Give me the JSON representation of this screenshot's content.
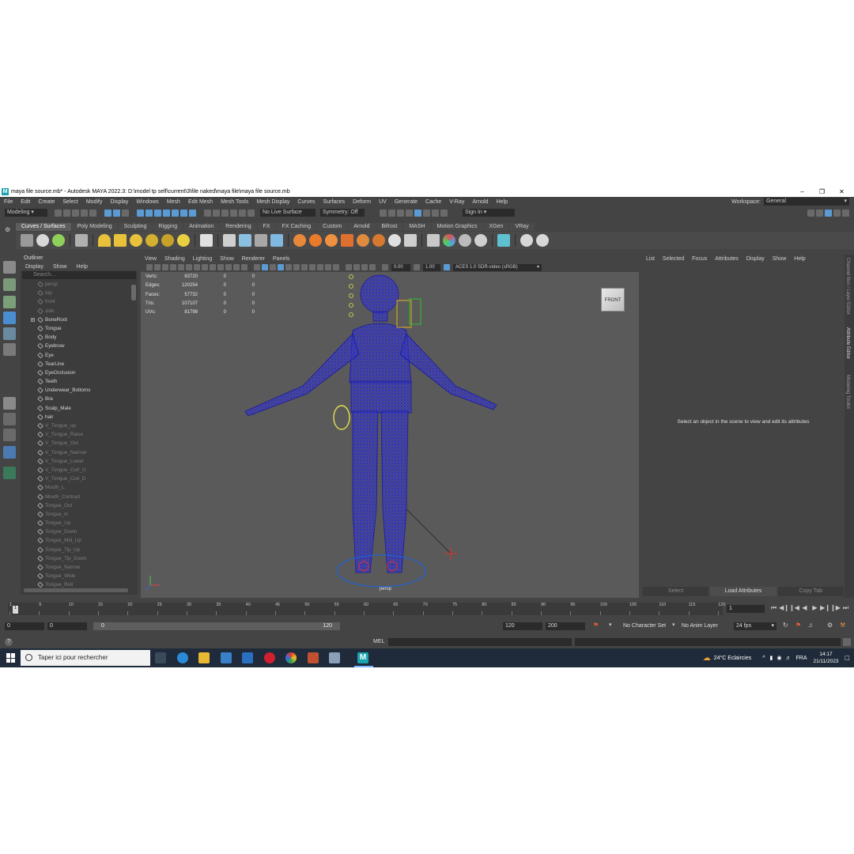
{
  "window": {
    "title": "maya file source.mb* - Autodesk MAYA 2022.3: D:\\model tp self\\current\\3\\file naked\\maya file\\maya file source.mb"
  },
  "menubar": [
    "File",
    "Edit",
    "Create",
    "Select",
    "Modify",
    "Display",
    "Windows",
    "Mesh",
    "Edit Mesh",
    "Mesh Tools",
    "Mesh Display",
    "Curves",
    "Surfaces",
    "Deform",
    "UV",
    "Generate",
    "Cache",
    "V-Ray",
    "Arnold",
    "Help"
  ],
  "workspace": {
    "label": "Workspace:",
    "value": "General"
  },
  "statusline": {
    "mode": "Modeling",
    "live_surface": "No Live Surface",
    "symmetry": "Symmetry: Off",
    "sign_in": "Sign In"
  },
  "shelf_tabs": [
    "Curves / Surfaces",
    "Poly Modeling",
    "Sculpting",
    "Rigging",
    "Animation",
    "Rendering",
    "FX",
    "FX Caching",
    "Custom",
    "Arnold",
    "Bifrost",
    "MASH",
    "Motion Graphics",
    "XGen",
    "VRay"
  ],
  "shelf_active": "Curves / Surfaces",
  "outliner": {
    "title": "Outliner",
    "menus": [
      "Display",
      "Show",
      "Help"
    ],
    "search_placeholder": "Search...",
    "items": [
      {
        "label": "persp",
        "dim": true
      },
      {
        "label": "top",
        "dim": true
      },
      {
        "label": "front",
        "dim": true
      },
      {
        "label": "side",
        "dim": true
      },
      {
        "label": "BoneRoot",
        "dim": false
      },
      {
        "label": "Tongue",
        "dim": false
      },
      {
        "label": "Body",
        "dim": false
      },
      {
        "label": "Eyebrow",
        "dim": false
      },
      {
        "label": "Eye",
        "dim": false
      },
      {
        "label": "TearLine",
        "dim": false
      },
      {
        "label": "EyeOcclusion",
        "dim": false
      },
      {
        "label": "Teeth",
        "dim": false
      },
      {
        "label": "Underwear_Bottoms",
        "dim": false
      },
      {
        "label": "Bra",
        "dim": false
      },
      {
        "label": "Scalp_Male",
        "dim": false
      },
      {
        "label": "hair",
        "dim": false
      },
      {
        "label": "V_Tongue_up",
        "dim": true
      },
      {
        "label": "V_Tongue_Raise",
        "dim": true
      },
      {
        "label": "V_Tongue_Out",
        "dim": true
      },
      {
        "label": "V_Tongue_Narrow",
        "dim": true
      },
      {
        "label": "V_Tongue_Lower",
        "dim": true
      },
      {
        "label": "V_Tongue_Curl_U",
        "dim": true
      },
      {
        "label": "V_Tongue_Curl_D",
        "dim": true
      },
      {
        "label": "Mouth_L",
        "dim": true
      },
      {
        "label": "Mouth_Contract",
        "dim": true
      },
      {
        "label": "Tongue_Out",
        "dim": true
      },
      {
        "label": "Tongue_In",
        "dim": true
      },
      {
        "label": "Tongue_Up",
        "dim": true
      },
      {
        "label": "Tongue_Down",
        "dim": true
      },
      {
        "label": "Tongue_Mid_Up",
        "dim": true
      },
      {
        "label": "Tongue_Tip_Up",
        "dim": true
      },
      {
        "label": "Tongue_Tip_Down",
        "dim": true
      },
      {
        "label": "Tongue_Narrow",
        "dim": true
      },
      {
        "label": "Tongue_Wide",
        "dim": true
      },
      {
        "label": "Tongue_Roll",
        "dim": true
      }
    ]
  },
  "viewport": {
    "menus": [
      "View",
      "Shading",
      "Lighting",
      "Show",
      "Renderer",
      "Panels"
    ],
    "exposure": "0.00",
    "gamma": "1.00",
    "color_space": "ACES 1.0 SDR-video (sRGB)",
    "camera": "persp",
    "viewcube_label": "FRONT",
    "hud": [
      {
        "label": "Verts:",
        "a": "63720",
        "b": "0",
        "c": "0"
      },
      {
        "label": "Edges:",
        "a": "120254",
        "b": "0",
        "c": "0"
      },
      {
        "label": "Faces:",
        "a": "57732",
        "b": "0",
        "c": "0"
      },
      {
        "label": "Tris:",
        "a": "107107",
        "b": "0",
        "c": "0"
      },
      {
        "label": "UVs:",
        "a": "81798",
        "b": "0",
        "c": "0"
      }
    ]
  },
  "attribute_editor": {
    "menus": [
      "List",
      "Selected",
      "Focus",
      "Attributes",
      "Display",
      "Show",
      "Help"
    ],
    "message": "Select an object in the scene to view and edit its attributes",
    "buttons": [
      "Select",
      "Load Attributes",
      "Copy Tab"
    ]
  },
  "side_tabs": [
    "Channel Box / Layer Editor",
    "Attribute Editor",
    "Modeling Toolkit"
  ],
  "timeslider": {
    "ticks": [
      "1",
      "5",
      "10",
      "15",
      "20",
      "25",
      "30",
      "35",
      "40",
      "45",
      "50",
      "55",
      "60",
      "65",
      "70",
      "75",
      "80",
      "85",
      "90",
      "95",
      "100",
      "105",
      "110",
      "115",
      "120"
    ],
    "current_frame": "1",
    "end_label": "120"
  },
  "rangeslider": {
    "start": "0",
    "start2": "0",
    "bar_start": "0",
    "bar_end": "120",
    "end": "120",
    "max": "200",
    "character_set": "No Character Set",
    "anim_layer": "No Anim Layer",
    "fps": "24 fps"
  },
  "cmdline": {
    "lang": "MEL",
    "help": "?"
  },
  "taskbar": {
    "search_placeholder": "Taper ici pour rechercher",
    "weather": "24°C  Eclaircies",
    "lang": "FRA",
    "time": "14:17",
    "date": "21/11/2023"
  }
}
